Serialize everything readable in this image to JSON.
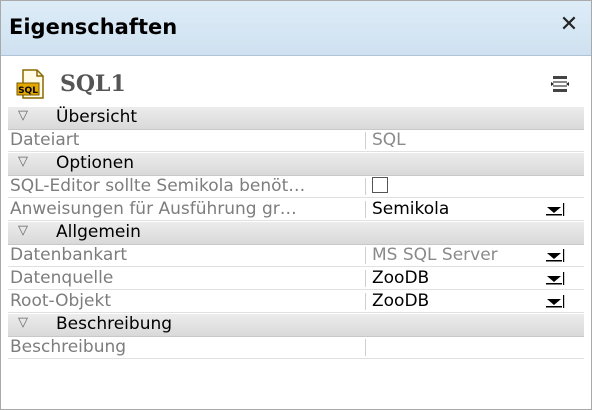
{
  "window": {
    "title": "Eigenschaften"
  },
  "object": {
    "name": "SQL1",
    "icon": "sql-file-icon"
  },
  "sections": {
    "overview": {
      "title": "Übersicht"
    },
    "options": {
      "title": "Optionen"
    },
    "general": {
      "title": "Allgemein"
    },
    "description": {
      "title": "Beschreibung"
    }
  },
  "properties": {
    "file_type": {
      "label": "Dateiart",
      "value": "SQL"
    },
    "require_semicolons": {
      "label": "SQL-Editor sollte Semikola benöt…",
      "checked": false
    },
    "group_for_execution": {
      "label": "Anweisungen für Ausführung gr…",
      "value": "Semikola"
    },
    "database_kind": {
      "label": "Datenbankart",
      "value": "MS SQL Server"
    },
    "data_source": {
      "label": "Datenquelle",
      "value": "ZooDB"
    },
    "root_object": {
      "label": "Root-Objekt",
      "value": "ZooDB"
    },
    "description": {
      "label": "Beschreibung",
      "value": ""
    }
  }
}
